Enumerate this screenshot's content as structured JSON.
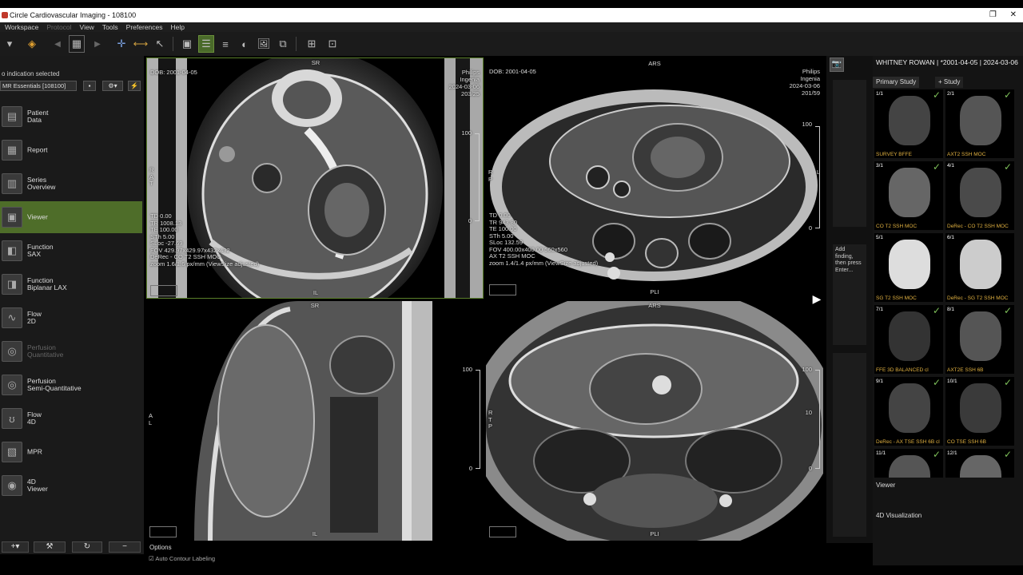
{
  "app": {
    "title": "Circle Cardiovascular Imaging - 108100"
  },
  "menu": [
    {
      "label": "Workspace",
      "enabled": true
    },
    {
      "label": "Protocol",
      "enabled": false
    },
    {
      "label": "View",
      "enabled": true
    },
    {
      "label": "Tools",
      "enabled": true
    },
    {
      "label": "Preferences",
      "enabled": true
    },
    {
      "label": "Help",
      "enabled": true
    }
  ],
  "sidebar": {
    "indication": "o indication selected",
    "protocol_select": "MR Essentials [108100]",
    "items": [
      {
        "label": "Patient\nData",
        "icon": "patient-data-icon",
        "state": "normal"
      },
      {
        "label": "Report",
        "icon": "report-icon",
        "state": "normal"
      },
      {
        "label": "Series\nOverview",
        "icon": "series-overview-icon",
        "state": "normal"
      },
      {
        "label": "Viewer",
        "icon": "viewer-icon",
        "state": "active"
      },
      {
        "label": "Function\nSAX",
        "icon": "function-sax-icon",
        "state": "normal"
      },
      {
        "label": "Function\nBiplanar LAX",
        "icon": "function-lax-icon",
        "state": "normal"
      },
      {
        "label": "Flow\n2D",
        "icon": "flow-2d-icon",
        "state": "normal"
      },
      {
        "label": "Perfusion\nQuantitative",
        "icon": "perfusion-quant-icon",
        "state": "disabled"
      },
      {
        "label": "Perfusion\nSemi-Quantitative",
        "icon": "perfusion-semi-icon",
        "state": "normal"
      },
      {
        "label": "Flow\n4D",
        "icon": "flow-4d-icon",
        "state": "normal"
      },
      {
        "label": "MPR",
        "icon": "mpr-icon",
        "state": "normal"
      },
      {
        "label": "4D\nViewer",
        "icon": "4d-viewer-icon",
        "state": "normal"
      }
    ]
  },
  "viewports": {
    "vp1": {
      "dob": "DOB: 2001-04-05",
      "vendor": "Philips",
      "model": "Ingenia",
      "date": "2024-03-06",
      "slice": "203/25",
      "orient_top": "SR",
      "orient_left": "R\nA\nT",
      "orient_bottom": "IL",
      "scale_top": "100",
      "scale_bottom": "0",
      "params": "TD 0.00\nTR 1008.13\nTE 100.00\nSTh 5.00\nSLoc -27.69\nFOV 429.97x429.97x432x432\nDeRec - CO T2 SSH MOC\nzoom 1.6/1.6 px/mm (ViewSize adjusted)"
    },
    "vp2": {
      "dob": "DOB: 2001-04-05",
      "vendor": "Philips",
      "model": "Ingenia",
      "date": "2024-03-06",
      "slice": "201/59",
      "orient_top": "ARS",
      "orient_left": "R\nP",
      "orient_right": "L",
      "orient_bottom": "PLI",
      "scale_top": "100",
      "scale_bottom": "0",
      "params": "TD 0.00\nTR 943.80\nTE 100.00\nSTh 5.00\nSLoc 132.59\nFOV 400.00x400.00 560x560\nAX T2 SSH MOC\nzoom 1.4/1.4 px/mm (ViewSize adjusted)"
    },
    "vp3": {
      "orient_top": "SR",
      "orient_left": "A\nL",
      "orient_bottom": "IL",
      "scale_top": "100",
      "scale_bottom": "0"
    },
    "vp4": {
      "orient_top": "ARS",
      "orient_left": "R\nT\nP",
      "orient_bottom": "PLI",
      "scale_top": "100",
      "scale_bottom": "0",
      "scale_mid": "10"
    }
  },
  "findings": {
    "prompt": "Add finding, then press Enter..."
  },
  "study": {
    "header": "WHITNEY ROWAN | *2001-04-05 | 2024-03-06",
    "tabs": [
      "Primary Study",
      "+ Study"
    ],
    "thumbnails": [
      {
        "num": "1/1",
        "label": "SURVEY BFFE",
        "checked": true
      },
      {
        "num": "2/1",
        "label": "AXT2 SSH MOC",
        "checked": true
      },
      {
        "num": "3/1",
        "label": "CO T2 SSH MOC",
        "checked": true
      },
      {
        "num": "4/1",
        "label": "DeRec - CO T2 SSH MOC",
        "checked": true
      },
      {
        "num": "5/1",
        "label": "SG T2 SSH MOC",
        "checked": false
      },
      {
        "num": "6/1",
        "label": "DeRec - SG T2 SSH MOC",
        "checked": false
      },
      {
        "num": "7/1",
        "label": "FFE 3D BALANCED cl",
        "checked": true
      },
      {
        "num": "8/1",
        "label": "AXT2E SSH 6B",
        "checked": true
      },
      {
        "num": "9/1",
        "label": "DeRec - AX TSE SSH 6B cl",
        "checked": true
      },
      {
        "num": "10/1",
        "label": "CO TSE SSH 6B",
        "checked": true
      },
      {
        "num": "11/1",
        "label": "",
        "checked": true
      },
      {
        "num": "12/1",
        "label": "",
        "checked": true
      }
    ],
    "sections": [
      "Viewer",
      "4D Visualization"
    ]
  },
  "options": {
    "label": "Options",
    "auto_contour": "Auto Contour Labeling"
  },
  "colors": {
    "accent": "#4e6d29",
    "check": "#7ec05a",
    "thumb_label": "#e0b040"
  }
}
